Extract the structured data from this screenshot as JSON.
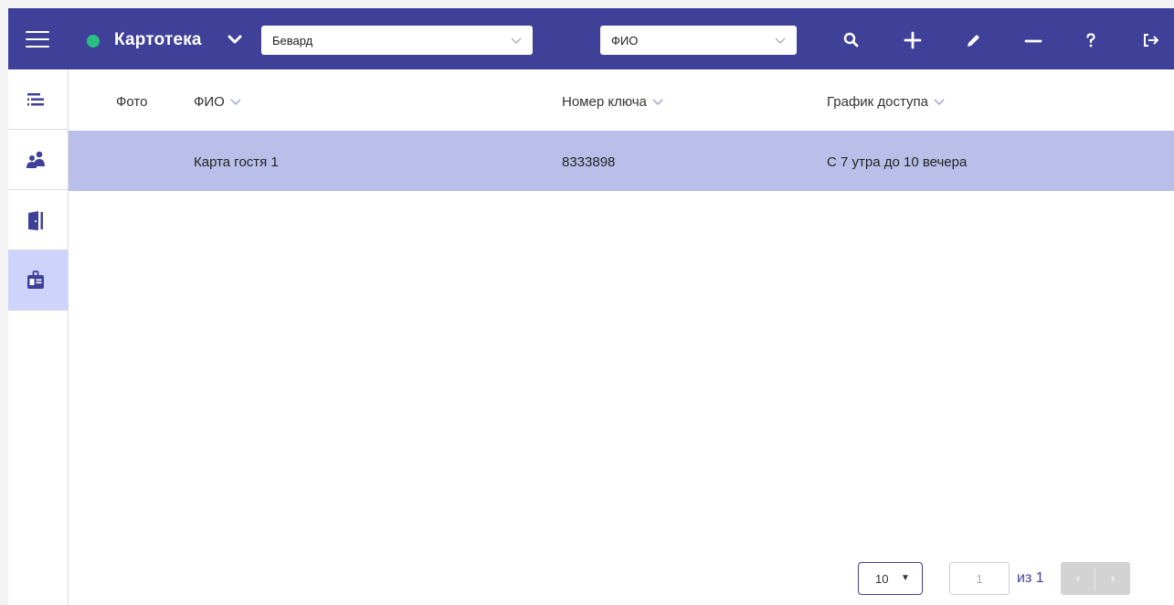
{
  "colors": {
    "topbar": "#3f4199",
    "status_dot": "#2bbf84",
    "selected_row": "#babfe9",
    "active_sidebar": "#cdd3fb"
  },
  "header": {
    "title": "Картотека",
    "building_select": {
      "value": "Бевард"
    },
    "field_select": {
      "value": "ФИО"
    },
    "icons": [
      "menu-icon",
      "chevron-down-icon",
      "search-icon",
      "plus-icon",
      "pencil-icon",
      "minus-icon",
      "help-icon",
      "logout-icon"
    ]
  },
  "sidebar": {
    "items": [
      {
        "icon": "list-icon",
        "active": false
      },
      {
        "icon": "users-icon",
        "active": false
      },
      {
        "icon": "door-icon",
        "active": false
      },
      {
        "icon": "id-badge-icon",
        "active": true
      }
    ]
  },
  "table": {
    "columns": [
      "Фото",
      "ФИО",
      "Номер ключа",
      "График доступа"
    ],
    "rows": [
      {
        "photo": "",
        "name": "Карта гостя 1",
        "key_number": "8333898",
        "schedule": "С 7 утра до 10 вечера",
        "selected": true
      }
    ]
  },
  "pagination": {
    "page_size": "10",
    "current_page": "1",
    "of_label": "из 1",
    "prev": "‹",
    "next": "›"
  }
}
